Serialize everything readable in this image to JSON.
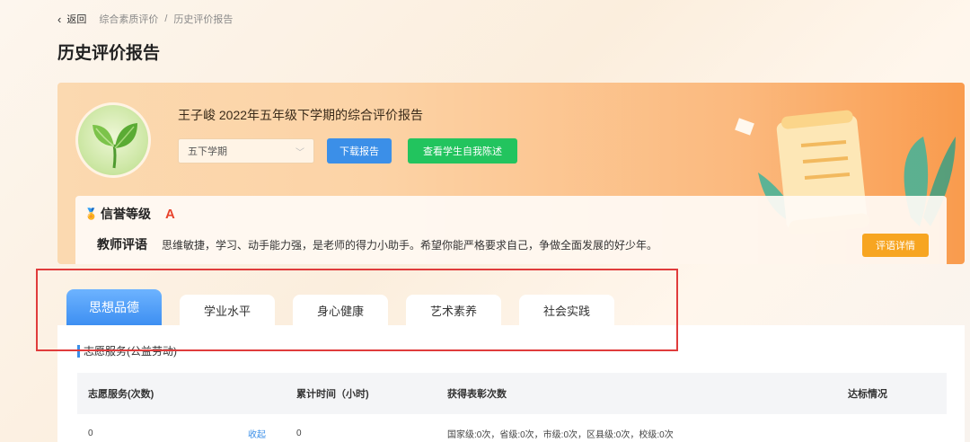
{
  "breadcrumb": {
    "back_label": "返回",
    "items": [
      "综合素质评价",
      "历史评价报告"
    ]
  },
  "page_title": "历史评价报告",
  "report": {
    "title": "王子峻  2022年五年级下学期的综合评价报告",
    "semester_selected": "五下学期",
    "download_label": "下载报告",
    "self_statement_label": "查看学生自我陈述"
  },
  "credit": {
    "label": "信誉等级",
    "grade": "A"
  },
  "teacher_comment": {
    "label": "教师评语",
    "text": "思维敏捷，学习、动手能力强，是老师的得力小助手。希望你能严格要求自己，争做全面发展的好少年。",
    "detail_label": "评语详情"
  },
  "tabs": [
    {
      "label": "思想品德",
      "active": true
    },
    {
      "label": "学业水平",
      "active": false
    },
    {
      "label": "身心健康",
      "active": false
    },
    {
      "label": "艺术素养",
      "active": false
    },
    {
      "label": "社会实践",
      "active": false
    }
  ],
  "section": {
    "title": "志愿服务(公益劳动)",
    "columns": [
      "志愿服务(次数)",
      "累计时间（小时)",
      "获得表彰次数",
      "达标情况"
    ],
    "rows": [
      {
        "count": "0",
        "toggle": "收起",
        "hours": "0",
        "awards": "国家级:0次，省级:0次，市级:0次，区县级:0次，校级:0次",
        "status": ""
      }
    ]
  },
  "colors": {
    "primary_blue": "#3b8fe8",
    "green": "#22c45e",
    "orange": "#f7a521",
    "grade_red": "#e8432c",
    "highlight_red": "#e03c3c"
  }
}
